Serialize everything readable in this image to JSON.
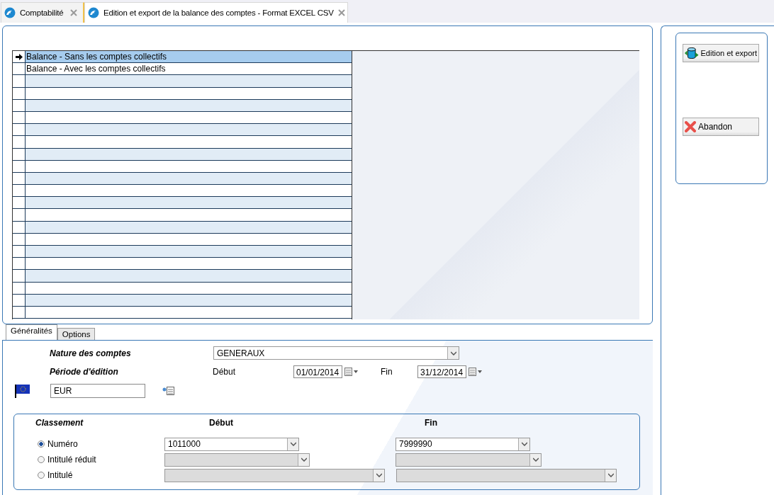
{
  "tabs": [
    {
      "label": "Comptabilité",
      "selected": false
    },
    {
      "label": "Edition et export de la balance des comptes - Format EXCEL CSV",
      "selected": true
    }
  ],
  "list": {
    "rows": [
      {
        "label": "Balance - Sans les comptes collectifs",
        "selected": true
      },
      {
        "label": "Balance - Avec les comptes collectifs",
        "selected": false
      }
    ]
  },
  "actions": [
    {
      "label": "Edition et export",
      "kind": "export"
    },
    {
      "label": "Abandon",
      "kind": "cancel"
    }
  ],
  "subtabs": [
    {
      "label": "Généralités",
      "selected": true
    },
    {
      "label": "Options",
      "selected": false
    }
  ],
  "nature": {
    "label": "Nature des comptes",
    "value": "GENERAUX"
  },
  "periode": {
    "label": "Période d'édition",
    "start_label": "Début",
    "start": "01/01/2014",
    "end_label": "Fin",
    "end": "31/12/2014"
  },
  "currency": {
    "value": "EUR"
  },
  "classement": {
    "title": "Classement",
    "start_header": "Début",
    "end_header": "Fin",
    "rows": [
      {
        "label": "Numéro",
        "selected": true,
        "start": "1011000",
        "end": "7999990",
        "disabled": false
      },
      {
        "label": "Intitulé réduit",
        "selected": false,
        "disabled": true
      },
      {
        "label": "Intitulé",
        "selected": false,
        "disabled": true
      }
    ]
  }
}
